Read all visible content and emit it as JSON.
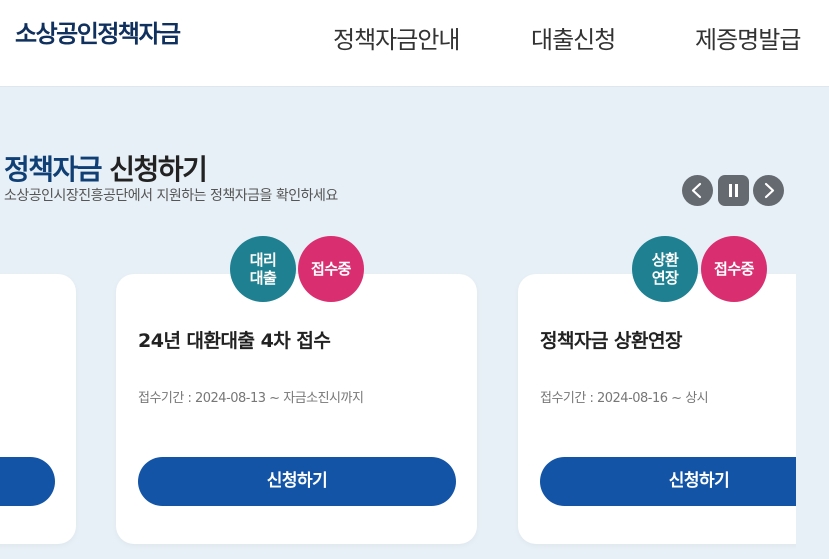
{
  "header": {
    "logo": "소상공인정책자금",
    "nav": [
      "정책자금안내",
      "대출신청",
      "제증명발급"
    ]
  },
  "section": {
    "title_accent": "정책자금",
    "title_rest": " 신청하기",
    "subtitle": "소상공인시장진흥공단에서 지원하는 정책자금을 확인하세요"
  },
  "carousel_controls": {
    "prev_icon": "chevron-left-icon",
    "pause_icon": "pause-icon",
    "next_icon": "chevron-right-icon"
  },
  "cards": [
    {
      "title": "",
      "period": "",
      "button": ""
    },
    {
      "title": "24년 대환대출 4차 접수",
      "period": "접수기간 : 2024-08-13 ~ 자금소진시까지",
      "button": "신청하기",
      "type_badge": "대리 대출",
      "status_badge": "접수중"
    },
    {
      "title": "정책자금 상환연장",
      "period": "접수기간 : 2024-08-16 ~ 상시",
      "button": "신청하기",
      "type_badge": "상환 연장",
      "status_badge": "접수중"
    }
  ],
  "colors": {
    "brand_navy": "#10305e",
    "button_blue": "#1354a6",
    "badge_teal": "#1e8090",
    "badge_pink": "#d92f71",
    "background": "#e8f0f7"
  }
}
